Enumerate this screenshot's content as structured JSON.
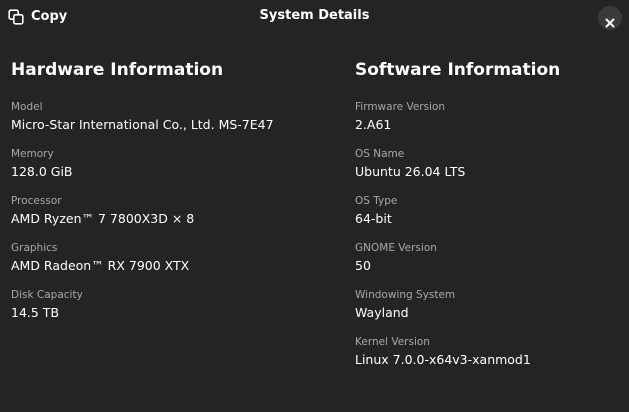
{
  "header": {
    "copy_label": "Copy",
    "copy_icon": "copy-icon",
    "title": "System Details",
    "close_icon": "close-icon"
  },
  "hardware": {
    "title": "Hardware Information",
    "rows": [
      {
        "label": "Model",
        "value": "Micro-Star International Co., Ltd. MS-7E47"
      },
      {
        "label": "Memory",
        "value": "128.0 GiB"
      },
      {
        "label": "Processor",
        "value": "AMD Ryzen™ 7 7800X3D × 8"
      },
      {
        "label": "Graphics",
        "value": "AMD Radeon™ RX 7900 XTX"
      },
      {
        "label": "Disk Capacity",
        "value": "14.5 TB"
      }
    ]
  },
  "software": {
    "title": "Software Information",
    "rows": [
      {
        "label": "Firmware Version",
        "value": "2.A61"
      },
      {
        "label": "OS Name",
        "value": "Ubuntu 26.04 LTS"
      },
      {
        "label": "OS Type",
        "value": "64-bit"
      },
      {
        "label": "GNOME Version",
        "value": "50"
      },
      {
        "label": "Windowing System",
        "value": "Wayland"
      },
      {
        "label": "Kernel Version",
        "value": "Linux 7.0.0-x64v3-xanmod1"
      }
    ]
  },
  "colors": {
    "background": "#242424",
    "text": "#ffffff",
    "label": "#a8a8a8",
    "close_button_bg": "#3a3a3a"
  }
}
